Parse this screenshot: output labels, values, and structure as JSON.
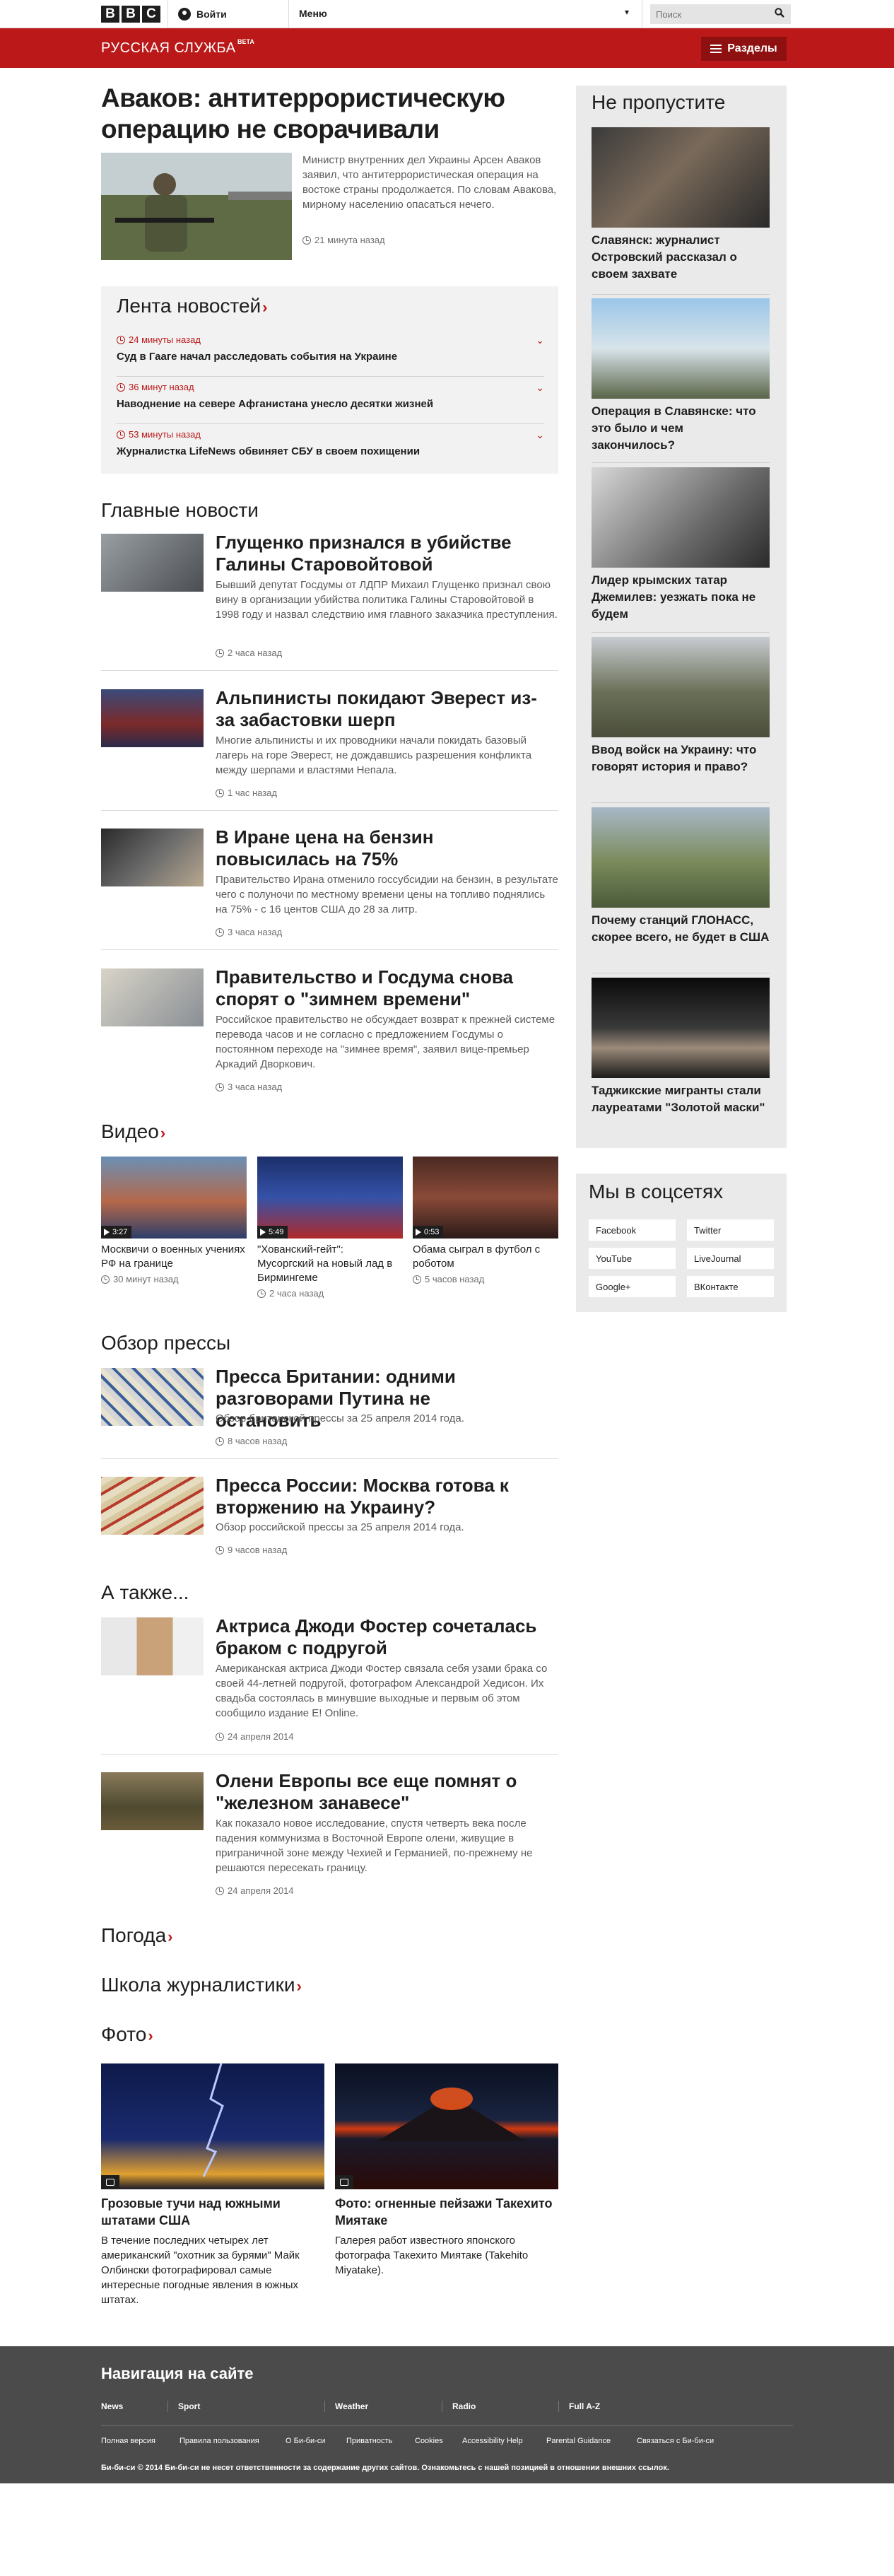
{
  "topbar": {
    "logo_letters": [
      "B",
      "B",
      "C"
    ],
    "signin_label": "Войти",
    "menu_label": "Меню",
    "search_placeholder": "Поиск"
  },
  "redbar": {
    "service_name": "РУССКАЯ СЛУЖБА",
    "beta_label": "BETA",
    "sections_label": "Разделы"
  },
  "lead": {
    "headline": "Аваков: антитеррористическую операцию не сворачивали",
    "summary": "Министр внутренних дел Украины Арсен Аваков заявил, что антитеррористическая операция на востоке страны продолжается. По словам Авакова, мирному населению опасаться нечего.",
    "time": "21 минута назад"
  },
  "feed": {
    "title": "Лента новостей",
    "items": [
      {
        "time": "24 минуты назад",
        "text": "Суд в Гааге начал расследовать события на Украине"
      },
      {
        "time": "36 минут назад",
        "text": "Наводнение на севере Афганистана унесло десятки жизней"
      },
      {
        "time": "53 минуты назад",
        "text": "Журналистка LifeNews обвиняет СБУ в своем похищении"
      }
    ]
  },
  "main_news": {
    "title": "Главные новости",
    "items": [
      {
        "headline": "Глущенко признался в убийстве Галины Старовойтовой",
        "summary": "Бывший депутат Госдумы от ЛДПР Михаил Глущенко признал свою вину в организации убийства политика Галины Старовойтовой в 1998 году и назвал следствию имя главного заказчика преступления.",
        "time": "2 часа назад"
      },
      {
        "headline": "Альпинисты покидают Эверест из-за забастовки шерп",
        "summary": "Многие альпинисты и их проводники начали покидать базовый лагерь на горе Эверест, не дождавшись разрешения конфликта между шерпами и властями Непала.",
        "time": "1 час назад"
      },
      {
        "headline": "В Иране цена на бензин повысилась на 75%",
        "summary": "Правительство Ирана отменило госсубсидии на бензин, в результате чего с полуночи по местному времени цены на топливо поднялись на 75% - с 16 центов США до 28 за литр.",
        "time": "3 часа назад"
      },
      {
        "headline": "Правительство и Госдума снова спорят о \"зимнем времени\"",
        "summary": "Российское правительство не обсуждает возврат к прежней системе перевода часов и не согласно с предложением Госдумы о постоянном переходе на \"зимнее время\", заявил вице-премьер Аркадий Дворкович.",
        "time": "3 часа назад"
      }
    ]
  },
  "video": {
    "title": "Видео",
    "items": [
      {
        "duration": "3:27",
        "text": "Москвичи о военных учениях РФ на границе",
        "time": "30 минут назад"
      },
      {
        "duration": "5:49",
        "text": "\"Хованский-гейт\": Мусоргский на новый лад в Бирмингеме",
        "time": "2 часа назад"
      },
      {
        "duration": "0:53",
        "text": "Обама сыграл в футбол с роботом",
        "time": "5 часов назад"
      }
    ]
  },
  "press": {
    "title": "Обзор прессы",
    "items": [
      {
        "headline": "Пресса Британии: одними разговорами Путина не остановить",
        "summary": "Обзор британской прессы за 25 апреля 2014 года.",
        "time": "8 часов назад"
      },
      {
        "headline": "Пресса России: Москва готова к вторжению на Украину?",
        "summary": "Обзор российской прессы за 25 апреля 2014 года.",
        "time": "9 часов назад"
      }
    ]
  },
  "also": {
    "title": "А также...",
    "items": [
      {
        "headline": "Актриса Джоди Фостер сочеталась браком с подругой",
        "summary": "Американская актриса Джоди Фостер связала себя узами брака со своей 44-летней подругой, фотографом Александрой Хедисон. Их свадьба состоялась в минувшие выходные и первым об этом сообщило издание E! Online.",
        "time": "24 апреля 2014"
      },
      {
        "headline": "Олени Европы все еще помнят о \"железном занавесе\"",
        "summary": "Как показало новое исследование, спустя четверть века после падения коммунизма в Восточной Европе олени, живущие в приграничной зоне между Чехией и Германией, по-прежнему не решаются пересекать границу.",
        "time": "24 апреля 2014"
      }
    ]
  },
  "weather_title": "Погода",
  "school_title": "Школа журналистики",
  "photo": {
    "title": "Фото",
    "items": [
      {
        "headline": "Грозовые тучи над южными штатами США",
        "summary": "В течение последних четырех лет американский \"охотник за бурями\" Майк Олбински фотографировал самые интересные погодные явления в южных штатах."
      },
      {
        "headline": "Фото: огненные пейзажи Такехито Миятаке",
        "summary": "Галерея работ известного японского фотографа Такехито Миятаке (Takehito Miyatake)."
      }
    ]
  },
  "sidebar": {
    "title": "Не пропустите",
    "items": [
      {
        "text": "Славянск: журналист Островский рассказал о своем захвате"
      },
      {
        "text": "Операция в Славянске: что это было и чем закончилось?"
      },
      {
        "text": "Лидер крымских татар Джемилев: уезжать пока не будем"
      },
      {
        "text": "Ввод войск на Украину: что говорят история и право?"
      },
      {
        "text": "Почему станций ГЛОНАСС, скорее всего, не будет в США"
      },
      {
        "text": "Таджикские мигранты стали лауреатами \"Золотой маски\""
      }
    ]
  },
  "social": {
    "title": "Мы в соцсетях",
    "buttons": [
      "Facebook",
      "Twitter",
      "YouTube",
      "LiveJournal",
      "Google+",
      "ВКонтакте"
    ]
  },
  "footer": {
    "title": "Навигация на сайте",
    "nav": [
      "News",
      "Sport",
      "Weather",
      "Radio",
      "Full A-Z"
    ],
    "links": [
      "Полная версия",
      "Правила пользования",
      "О Би-би-си",
      "Приватность",
      "Cookies",
      "Accessibility Help",
      "Parental Guidance",
      "Связаться с Би-би-си"
    ],
    "copyright": "Би-би-си © 2014 Би-би-си не несет ответственности за содержание других сайтов.",
    "external_link": "Ознакомьтесь с нашей позицией в отношении внешних ссылок."
  }
}
